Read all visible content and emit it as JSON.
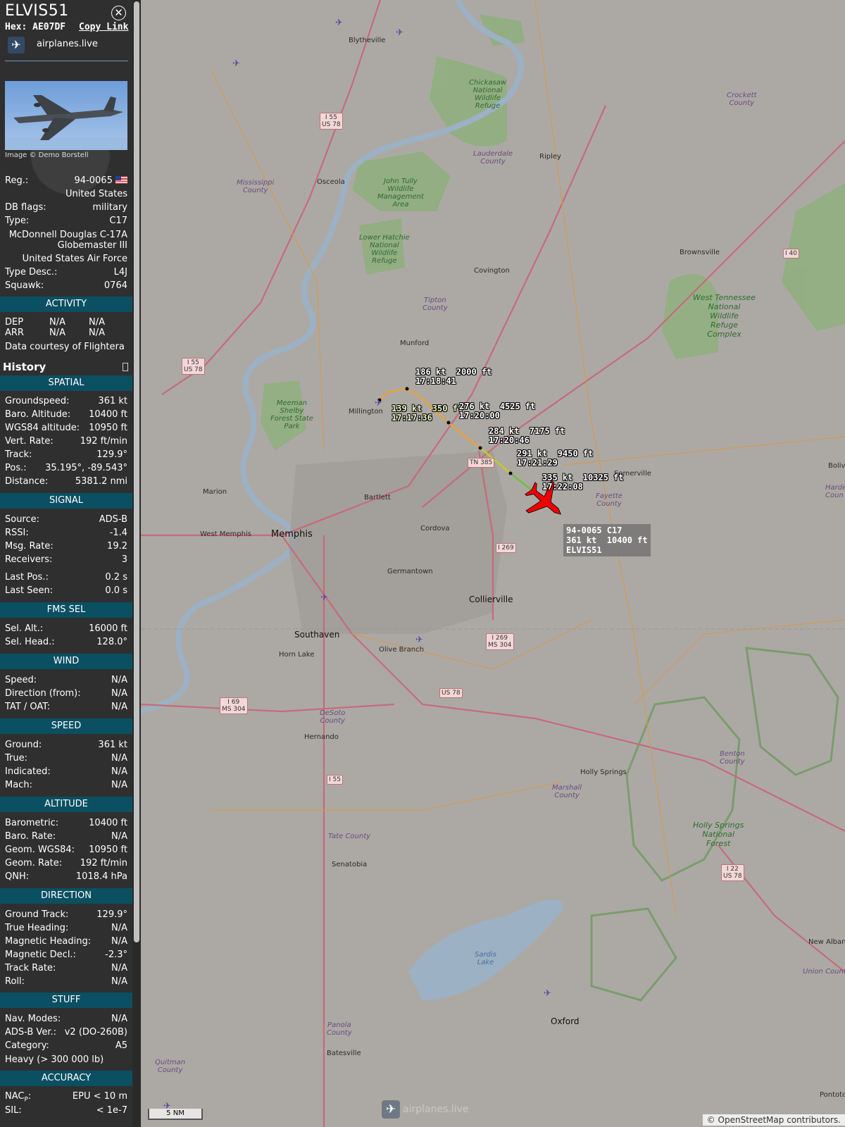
{
  "header": {
    "callsign": "ELVIS51",
    "close_glyph": "✕",
    "hex_label": "Hex: AE07DF",
    "copy_link": "Copy Link",
    "site_name": "airplanes.live"
  },
  "photo": {
    "caption": "Image © Demo Borstell"
  },
  "info": {
    "reg_label": "Reg.:",
    "reg": "94-0065",
    "country": "United States",
    "dbflags_label": "DB flags:",
    "dbflags": "military",
    "type_label": "Type:",
    "type": "C17",
    "model_line1": "McDonnell Douglas C-17A",
    "model_line2": "Globemaster III",
    "operator": "United States Air Force",
    "typedesc_label": "Type Desc.:",
    "typedesc": "L4J",
    "squawk_label": "Squawk:",
    "squawk": "0764"
  },
  "activity": {
    "title": "ACTIVITY",
    "dep_label": "DEP",
    "dep1": "N/A",
    "dep2": "N/A",
    "arr_label": "ARR",
    "arr1": "N/A",
    "arr2": "N/A",
    "courtesy": "Data courtesy of",
    "courtesy_link": "Flightera"
  },
  "history_label": "History",
  "spatial": {
    "title": "SPATIAL",
    "rows": [
      {
        "k": "Groundspeed:",
        "v": "361 kt"
      },
      {
        "k": "Baro. Altitude:",
        "v": "10400 ft"
      },
      {
        "k": "WGS84 altitude:",
        "v": "10950 ft"
      },
      {
        "k": "Vert. Rate:",
        "v": "192 ft/min"
      },
      {
        "k": "Track:",
        "v": "129.9°"
      },
      {
        "k": "Pos.:",
        "v": "35.195°, -89.543°"
      },
      {
        "k": "Distance:",
        "v": "5381.2 nmi"
      }
    ]
  },
  "signal": {
    "title": "SIGNAL",
    "rows": [
      {
        "k": "Source:",
        "v": "ADS-B"
      },
      {
        "k": "RSSI:",
        "v": "-1.4"
      },
      {
        "k": "Msg. Rate:",
        "v": "19.2"
      },
      {
        "k": "Receivers:",
        "v": "3"
      },
      {
        "k": "Last Pos.:",
        "v": "0.2 s"
      },
      {
        "k": "Last Seen:",
        "v": "0.0 s"
      }
    ]
  },
  "fms": {
    "title": "FMS SEL",
    "rows": [
      {
        "k": "Sel. Alt.:",
        "v": "16000 ft"
      },
      {
        "k": "Sel. Head.:",
        "v": "128.0°"
      }
    ]
  },
  "wind": {
    "title": "WIND",
    "rows": [
      {
        "k": "Speed:",
        "v": "N/A"
      },
      {
        "k": "Direction (from):",
        "v": "N/A"
      },
      {
        "k": "TAT / OAT:",
        "v": "N/A"
      }
    ]
  },
  "speed": {
    "title": "SPEED",
    "rows": [
      {
        "k": "Ground:",
        "v": "361 kt"
      },
      {
        "k": "True:",
        "v": "N/A"
      },
      {
        "k": "Indicated:",
        "v": "N/A"
      },
      {
        "k": "Mach:",
        "v": "N/A"
      }
    ]
  },
  "altitude": {
    "title": "ALTITUDE",
    "rows": [
      {
        "k": "Barometric:",
        "v": "10400 ft"
      },
      {
        "k": "Baro. Rate:",
        "v": "N/A"
      },
      {
        "k": "Geom. WGS84:",
        "v": "10950 ft"
      },
      {
        "k": "Geom. Rate:",
        "v": "192 ft/min"
      },
      {
        "k": "QNH:",
        "v": "1018.4 hPa"
      }
    ]
  },
  "direction": {
    "title": "DIRECTION",
    "rows": [
      {
        "k": "Ground Track:",
        "v": "129.9°"
      },
      {
        "k": "True Heading:",
        "v": "N/A"
      },
      {
        "k": "Magnetic Heading:",
        "v": "N/A"
      },
      {
        "k": "Magnetic Decl.:",
        "v": "-2.3°"
      },
      {
        "k": "Track Rate:",
        "v": "N/A"
      },
      {
        "k": "Roll:",
        "v": "N/A"
      }
    ]
  },
  "stuff": {
    "title": "STUFF",
    "rows": [
      {
        "k": "Nav. Modes:",
        "v": "N/A"
      },
      {
        "k": "ADS-B Ver.:",
        "v": "v2 (DO-260B)"
      },
      {
        "k": "Category:",
        "v": "A5"
      }
    ],
    "heavy": "Heavy (> 300 000 lb)"
  },
  "accuracy": {
    "title": "ACCURACY",
    "nacp_label": "NAC",
    "nacp_sub": "P",
    "nacp_colon": ":",
    "nacp": "EPU < 10 m",
    "sil_label": "SIL:",
    "sil": "< 1e-7"
  },
  "map": {
    "track_labels": [
      {
        "speed_alt": "186 kt  2000 ft",
        "time": "17:18:41"
      },
      {
        "speed_alt": "139 kt  350 ft",
        "time": "17:17:36"
      },
      {
        "speed_alt": "276 kt  4525 ft",
        "time": "17:20:00"
      },
      {
        "speed_alt": "284 kt  7175 ft",
        "time": "17:20:46"
      },
      {
        "speed_alt": "291 kt  9450 ft",
        "time": "17:21:29"
      },
      {
        "speed_alt": "335 kt  10325 ft",
        "time": "17:22:08"
      }
    ],
    "plane_tag": {
      "line1": "94-0065 C17",
      "line2": "361 kt  10400 ft",
      "line3": "ELVIS51"
    },
    "cities": {
      "blytheville": "Blytheville",
      "osceola": "Osceola",
      "ripley": "Ripley",
      "covington": "Covington",
      "brownsville": "Brownsville",
      "munford": "Munford",
      "millington": "Millington",
      "marion": "Marion",
      "west_memphis": "West Memphis",
      "memphis": "Memphis",
      "bartlett": "Bartlett",
      "cordova": "Cordova",
      "germantown": "Germantown",
      "collierville": "Collierville",
      "somerville": "Somerville",
      "southaven": "Southaven",
      "horn_lake": "Horn Lake",
      "olive_branch": "Olive Branch",
      "hernando": "Hernando",
      "holly_springs": "Holly Springs",
      "senatobia": "Senatobia",
      "oxford": "Oxford",
      "batesville": "Batesville",
      "new_albany": "New Albany",
      "pontotoc": "Pontoto",
      "bolivar": "Boliva"
    },
    "counties": {
      "crockett": "Crockett\nCounty",
      "lauderdale": "Lauderdale\nCounty",
      "mississippi": "Mississippi\nCounty",
      "tipton": "Tipton\nCounty",
      "fayette": "Fayette\nCounty",
      "desoto": "DeSoto\nCounty",
      "marshall": "Marshall\nCounty",
      "benton": "Benton\nCounty",
      "tate": "Tate County",
      "panola": "Panola\nCounty",
      "quitman": "Quitman\nCounty",
      "union": "Union County",
      "hardeman": "Harde\nCoun"
    },
    "parks": {
      "chickasaw": "Chickasaw\nNational\nWildlife\nRefuge",
      "johntully": "John Tully\nWildlife\nManagement\nArea",
      "lowerhatchie": "Lower Hatchie\nNational\nWildlife\nRefuge",
      "westtn": "West Tennessee\nNational\nWildlife\nRefuge\nComplex",
      "meeman": "Meeman\nShelby\nForest State\nPark",
      "hollysprings": "Holly Springs\nNational\nForest",
      "sardis": "Sardis\nLake"
    },
    "shields": {
      "i55a": "I 55\nUS 78",
      "i55b": "I 55\nUS 78",
      "i40": "I 40",
      "tn385": "TN 385",
      "i269a": "I 269",
      "i269b": "I 269\nMS 304",
      "i69": "I 69\nMS 304",
      "us78": "US 78",
      "i55c": "I 55",
      "i22": "I 22\nUS 78"
    },
    "scale": "5 NM",
    "attribution_prefix": "© ",
    "attribution_link": "OpenStreetMap",
    "attribution_suffix": " contributors.",
    "watermark": "airplanes.live"
  }
}
